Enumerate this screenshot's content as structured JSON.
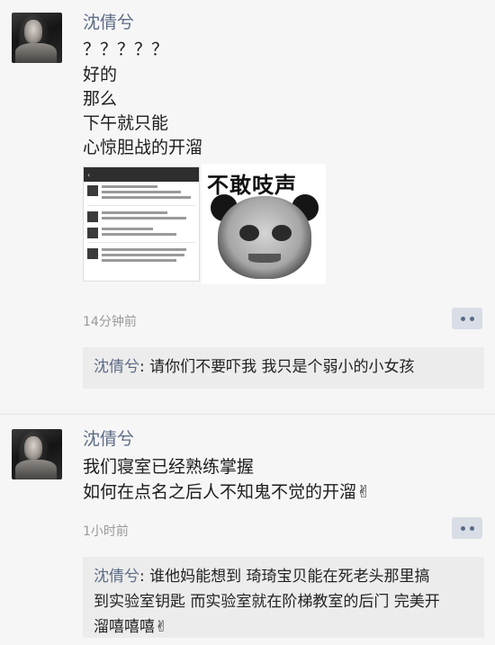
{
  "posts": [
    {
      "nickname": "沈倩兮",
      "lines": [
        "？？？？？",
        "好的",
        "那么",
        "下午就只能",
        "心惊胆战的开溜"
      ],
      "time": "14分钟前",
      "meme_caption": "不敢吱声",
      "comment": {
        "name": "沈倩兮",
        "separator": ": ",
        "text": "请你们不要吓我 我只是个弱小的小女孩"
      }
    },
    {
      "nickname": "沈倩兮",
      "lines": [
        "我们寝室已经熟练掌握",
        "如何在点名之后人不知鬼不觉的开溜✌"
      ],
      "time": "1小时前",
      "comment": {
        "name": "沈倩兮",
        "separator": ": ",
        "text_line1": "谁他妈能想到 琦琦宝贝能在死老头那里搞",
        "text_line2": "到实验室钥匙 而实验室就在阶梯教室的后门 完美开",
        "text_line3": "溜嘻嘻嘻✌"
      }
    }
  ],
  "icons": {
    "more": "more-dots-icon",
    "avatar": "avatar",
    "victory": "victory-hand-emoji"
  },
  "colors": {
    "nickname": "#5d6b86",
    "comment_bg": "#ececec",
    "more_btn_bg": "#d8dde6"
  }
}
